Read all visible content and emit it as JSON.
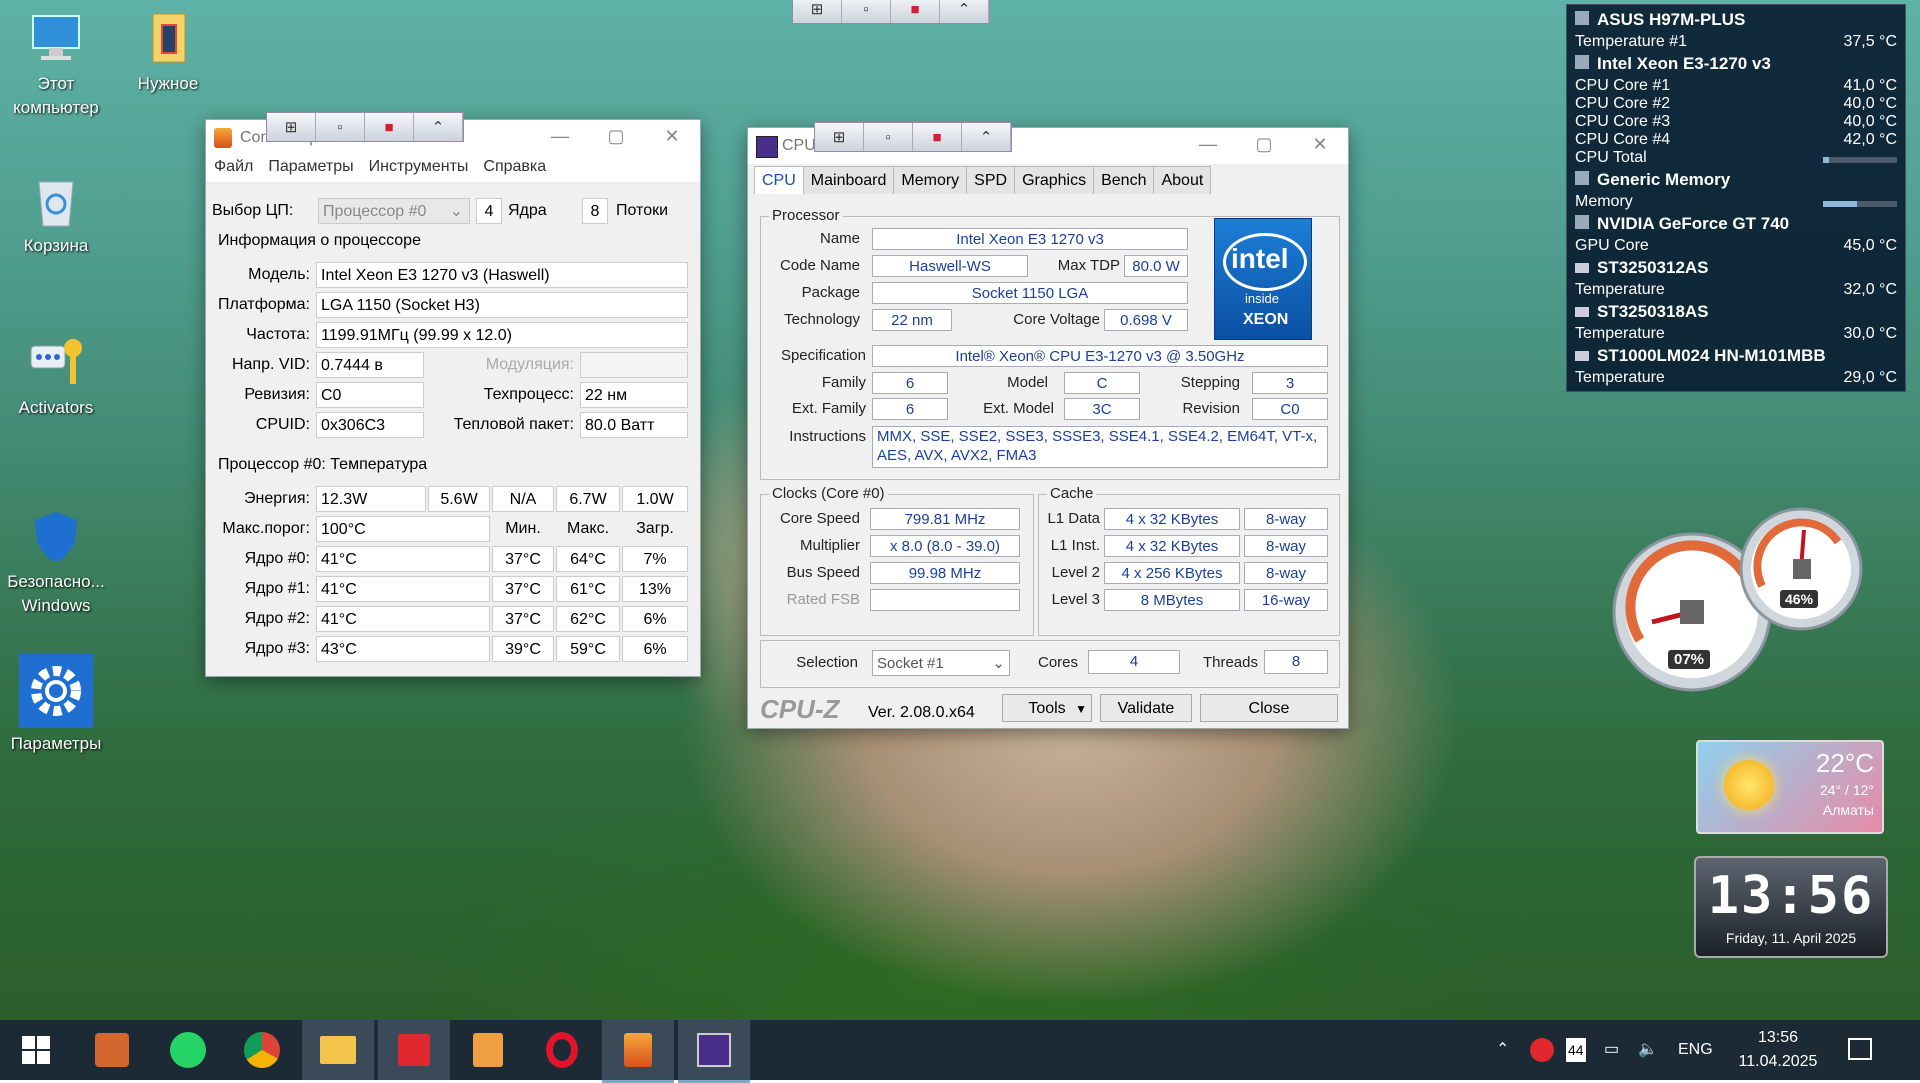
{
  "desktop": {
    "icons": [
      {
        "label": "Этот компьютер"
      },
      {
        "label": "Нужное"
      },
      {
        "label": "Корзина"
      },
      {
        "label": "Activators"
      },
      {
        "label": "Безопасно... Windows"
      },
      {
        "label": "Параметры"
      }
    ]
  },
  "coretemp": {
    "title": "Core Temp 1.18.1",
    "menu": [
      "Файл",
      "Параметры",
      "Инструменты",
      "Справка"
    ],
    "cpu_select_label": "Выбор ЦП:",
    "cpu_select_value": "Процессор #0",
    "cores_count": "4",
    "cores_label": "Ядра",
    "threads_count": "8",
    "threads_label": "Потоки",
    "info_title": "Информация о процессоре",
    "model_label": "Модель:",
    "model": "Intel Xeon E3 1270 v3 (Haswell)",
    "platform_label": "Платформа:",
    "platform": "LGA 1150 (Socket H3)",
    "freq_label": "Частота:",
    "freq": "1199.91МГц (99.99 x 12.0)",
    "vid_label": "Напр. VID:",
    "vid": "0.7444 в",
    "modulation_label": "Модуляция:",
    "modulation": "",
    "revision_label": "Ревизия:",
    "revision": "C0",
    "process_label": "Техпроцесс:",
    "process": "22 нм",
    "cpuid_label": "CPUID:",
    "cpuid": "0x306C3",
    "tdp_label": "Тепловой пакет:",
    "tdp": "80.0 Ватт",
    "temp_title": "Процессор #0: Температура",
    "power_label": "Энергия:",
    "power": [
      "12.3W",
      "5.6W",
      "N/A",
      "6.7W",
      "1.0W"
    ],
    "tjmax_label": "Макс.порог:",
    "tjmax": "100°C",
    "col_min": "Мин.",
    "col_max": "Макс.",
    "col_load": "Загр.",
    "cores": [
      {
        "label": "Ядро #0:",
        "temp": "41°C",
        "min": "37°C",
        "max": "64°C",
        "load": "7%"
      },
      {
        "label": "Ядро #1:",
        "temp": "41°C",
        "min": "37°C",
        "max": "61°C",
        "load": "13%"
      },
      {
        "label": "Ядро #2:",
        "temp": "41°C",
        "min": "37°C",
        "max": "62°C",
        "load": "6%"
      },
      {
        "label": "Ядро #3:",
        "temp": "43°C",
        "min": "39°C",
        "max": "59°C",
        "load": "6%"
      }
    ]
  },
  "cpuz": {
    "title": "CPU-Z",
    "tabs": [
      "CPU",
      "Mainboard",
      "Memory",
      "SPD",
      "Graphics",
      "Bench",
      "About"
    ],
    "processor_group": "Processor",
    "name_label": "Name",
    "name": "Intel Xeon E3 1270 v3",
    "codename_label": "Code Name",
    "codename": "Haswell-WS",
    "maxtdp_label": "Max TDP",
    "maxtdp": "80.0 W",
    "package_label": "Package",
    "package": "Socket 1150 LGA",
    "technology_label": "Technology",
    "technology": "22 nm",
    "corevoltage_label": "Core Voltage",
    "corevoltage": "0.698 V",
    "spec_label": "Specification",
    "spec": "Intel® Xeon® CPU E3-1270 v3 @ 3.50GHz",
    "family_label": "Family",
    "family": "6",
    "model_label": "Model",
    "model": "C",
    "stepping_label": "Stepping",
    "stepping": "3",
    "extfamily_label": "Ext. Family",
    "extfamily": "6",
    "extmodel_label": "Ext. Model",
    "extmodel": "3C",
    "revision_label": "Revision",
    "revision": "C0",
    "instructions_label": "Instructions",
    "instructions": "MMX, SSE, SSE2, SSE3, SSSE3, SSE4.1, SSE4.2, EM64T, VT-x, AES, AVX, AVX2, FMA3",
    "clocks_group": "Clocks (Core #0)",
    "corespeed_label": "Core Speed",
    "corespeed": "799.81 MHz",
    "multiplier_label": "Multiplier",
    "multiplier": "x 8.0 (8.0 - 39.0)",
    "busspeed_label": "Bus Speed",
    "busspeed": "99.98 MHz",
    "ratedfsb_label": "Rated FSB",
    "ratedfsb": "",
    "cache_group": "Cache",
    "cache": [
      {
        "label": "L1 Data",
        "size": "4 x 32 KBytes",
        "way": "8-way"
      },
      {
        "label": "L1 Inst.",
        "size": "4 x 32 KBytes",
        "way": "8-way"
      },
      {
        "label": "Level 2",
        "size": "4 x 256 KBytes",
        "way": "8-way"
      },
      {
        "label": "Level 3",
        "size": "8 MBytes",
        "way": "16-way"
      }
    ],
    "selection_label": "Selection",
    "selection": "Socket #1",
    "cores_label": "Cores",
    "cores": "4",
    "threads_label": "Threads",
    "threads": "8",
    "brand": "CPU-Z",
    "version": "Ver. 2.08.0.x64",
    "tools_label": "Tools",
    "validate_label": "Validate",
    "close_label": "Close",
    "logo_intel": "intel",
    "logo_inside": "inside",
    "logo_xeon": "XEON"
  },
  "hwmonitor": {
    "mb_name": "ASUS H97M-PLUS",
    "mb_temp_label": "Temperature #1",
    "mb_temp": "37,5 °C",
    "cpu_name": "Intel Xeon E3-1270 v3",
    "cpu_cores": [
      {
        "label": "CPU Core #1",
        "value": "41,0 °C"
      },
      {
        "label": "CPU Core #2",
        "value": "40,0 °C"
      },
      {
        "label": "CPU Core #3",
        "value": "40,0 °C"
      },
      {
        "label": "CPU Core #4",
        "value": "42,0 °C"
      }
    ],
    "cpu_total_label": "CPU Total",
    "cpu_total_fraction": 0.08,
    "mem_name": "Generic Memory",
    "mem_label": "Memory",
    "mem_fraction": 0.46,
    "gpu_name": "NVIDIA GeForce GT 740",
    "gpu_label": "GPU Core",
    "gpu_value": "45,0 °C",
    "disks": [
      {
        "name": "ST3250312AS",
        "label": "Temperature",
        "value": "32,0 °C"
      },
      {
        "name": "ST3250318AS",
        "label": "Temperature",
        "value": "30,0 °C"
      },
      {
        "name": "ST1000LM024 HN-M101MBB",
        "label": "Temperature",
        "value": "29,0 °C"
      }
    ]
  },
  "gauges": {
    "cpu_percent": "07%",
    "mem_percent": "46%"
  },
  "weather": {
    "temp": "22°C",
    "range": "24° / 12°",
    "city": "Алматы"
  },
  "clock": {
    "time": "13:56",
    "date": "Friday, 11. April 2025"
  },
  "tray": {
    "lang": "ENG",
    "time": "13:56",
    "date": "11.04.2025",
    "badge": "44"
  }
}
